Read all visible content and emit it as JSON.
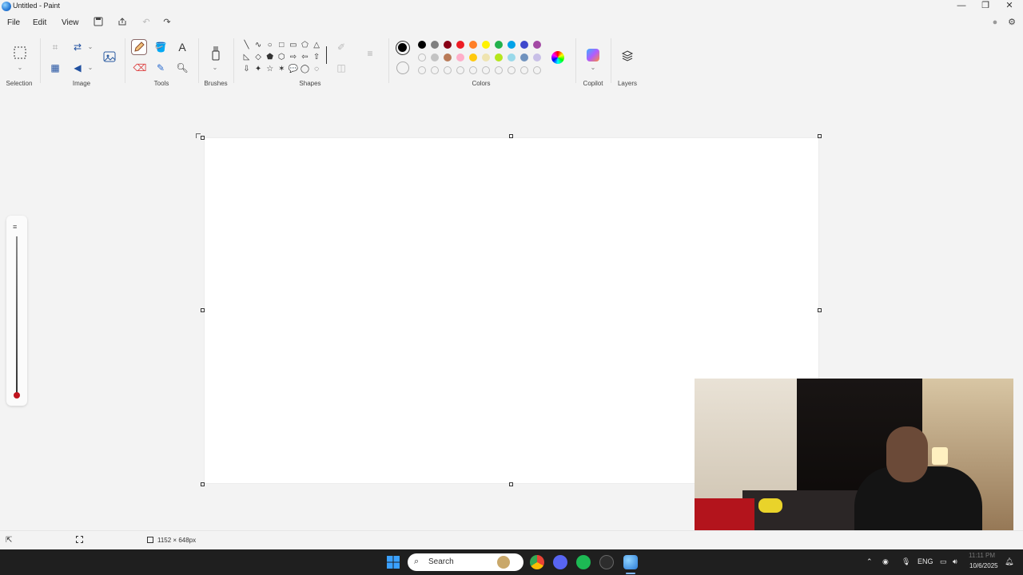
{
  "window": {
    "title": "Untitled - Paint",
    "controls": {
      "minimize": "—",
      "maximize": "❐",
      "close": "✕"
    }
  },
  "menu": {
    "items": [
      "File",
      "Edit",
      "View"
    ]
  },
  "ribbon": {
    "groups": {
      "selection": "Selection",
      "image": "Image",
      "tools": "Tools",
      "brushes": "Brushes",
      "shapes": "Shapes",
      "colors": "Colors",
      "copilot": "Copilot",
      "layers": "Layers"
    },
    "tools": {
      "text_tool": "A",
      "active_tool": "pencil"
    },
    "shape_glyphs": [
      "╲",
      "∿",
      "○",
      "□",
      "▭",
      "⬠",
      "△",
      "◺",
      "◇",
      "⬟",
      "⬡",
      "⇨",
      "⇦",
      "⇧",
      "⇩",
      "✦",
      "☆",
      "✶",
      "💬",
      "◯",
      "◌"
    ],
    "colors": {
      "current_primary": "#000000",
      "current_secondary": "#ffffff",
      "row1": [
        "#000000",
        "#7f7f7f",
        "#880015",
        "#ed1c24",
        "#ff7f27",
        "#fff200",
        "#22b14c",
        "#00a2e8",
        "#3f48cc",
        "#a349a4"
      ],
      "row2": [
        "#ffffff",
        "#c3c3c3",
        "#b97a57",
        "#ffaec9",
        "#ffc90e",
        "#efe4b0",
        "#b5e61d",
        "#99d9ea",
        "#7092be",
        "#c8bfe7"
      ],
      "row3_empty_count": 10
    }
  },
  "canvas": {
    "background": "#ffffff"
  },
  "brush_size": {
    "accent": "#c0141f",
    "level": 0.0
  },
  "status": {
    "canvas_size": "1152 × 648px"
  },
  "taskbar": {
    "search_placeholder": "Search",
    "language": "ENG",
    "time": "11:11 PM",
    "date": "10/6/2025"
  }
}
